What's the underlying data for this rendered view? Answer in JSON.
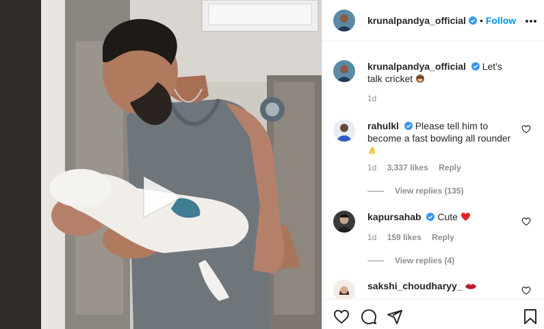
{
  "post": {
    "author": "krunalpandya_official",
    "follow_label": "Follow",
    "dot": "•",
    "caption": {
      "username": "krunalpandya_official",
      "text": "Let's talk cricket",
      "time": "1d"
    },
    "comments": [
      {
        "username": "rahulkl",
        "text": "Please tell him to become a fast bowling all rounder",
        "time": "1d",
        "likes": "3,337 likes",
        "reply_label": "Reply",
        "view_replies": "View replies (135)"
      },
      {
        "username": "kapursahab",
        "text": "Cute",
        "time": "1d",
        "likes": "159 likes",
        "reply_label": "Reply",
        "view_replies": "View replies (4)"
      },
      {
        "username": "sakshi_choudharyy_"
      }
    ]
  },
  "colors": {
    "accent": "#0095f6",
    "verified": "#3897f0",
    "heart": "#ed4956"
  },
  "icons": [
    "play-icon",
    "more-options-icon",
    "verified-badge-icon",
    "heart-icon",
    "comment-icon",
    "share-icon",
    "bookmark-icon",
    "monkey-emoji-icon",
    "folded-hands-emoji-icon",
    "red-heart-emoji-icon",
    "lips-emoji-icon"
  ]
}
